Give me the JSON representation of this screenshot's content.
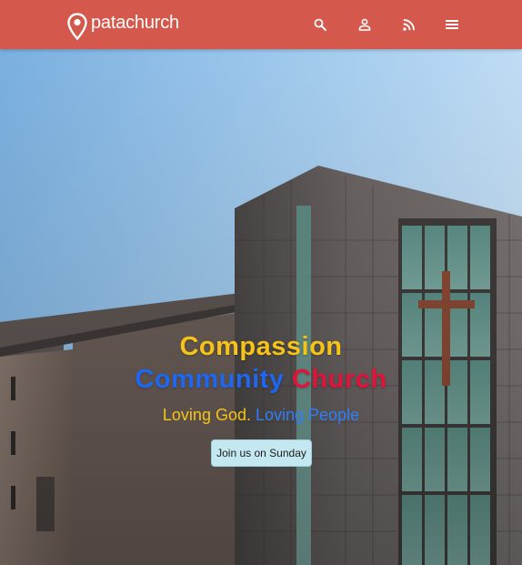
{
  "brand": {
    "name": "patachurch",
    "logo_icon": "map-pin-icon"
  },
  "nav": {
    "icons": [
      "search-icon",
      "account-icon",
      "rss-icon",
      "menu-icon"
    ],
    "color": "#d5584c"
  },
  "hero": {
    "title_line1": {
      "word": "Compassion",
      "color": "#f6c319"
    },
    "title_line2": [
      {
        "word": "Community",
        "color": "#1f66f0"
      },
      {
        "word": "Church",
        "color": "#e0143a"
      }
    ],
    "tagline": [
      {
        "text": "Loving God.",
        "color": "#f6c319"
      },
      {
        "text": "Loving People",
        "color": "#2f7ef7"
      }
    ],
    "cta_label": "Join us on Sunday"
  }
}
